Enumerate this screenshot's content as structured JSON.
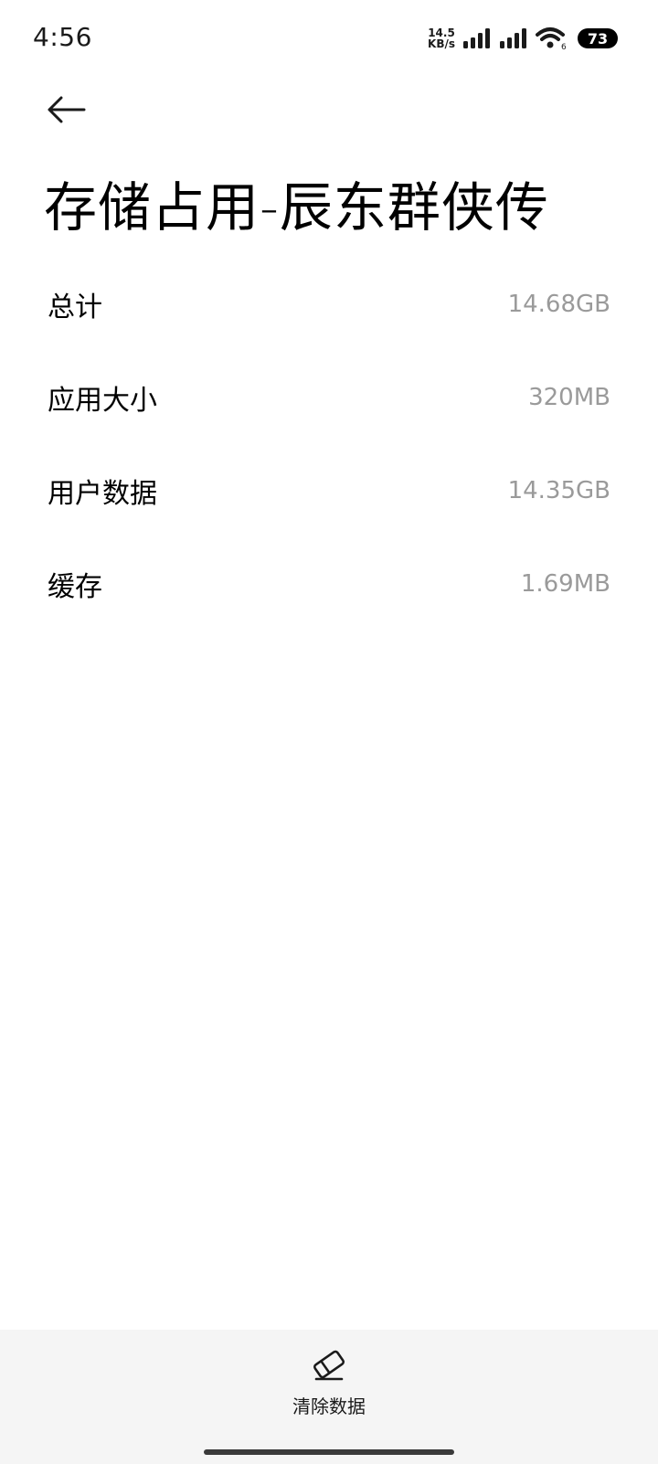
{
  "status_bar": {
    "time": "4:56",
    "net_speed_value": "14.5",
    "net_speed_unit": "KB/s",
    "wifi_badge": "6",
    "battery": "73"
  },
  "header": {
    "back_icon": "arrow-left-icon",
    "title": "存储占用-辰东群侠传"
  },
  "storage": {
    "rows": [
      {
        "label": "总计",
        "value": "14.68GB"
      },
      {
        "label": "应用大小",
        "value": "320MB"
      },
      {
        "label": "用户数据",
        "value": "14.35GB"
      },
      {
        "label": "缓存",
        "value": "1.69MB"
      }
    ]
  },
  "bottom_bar": {
    "clear_icon": "eraser-icon",
    "clear_label": "清除数据"
  },
  "colors": {
    "value_text": "#9a9a9a",
    "bottom_bar_bg": "#f5f5f5"
  }
}
